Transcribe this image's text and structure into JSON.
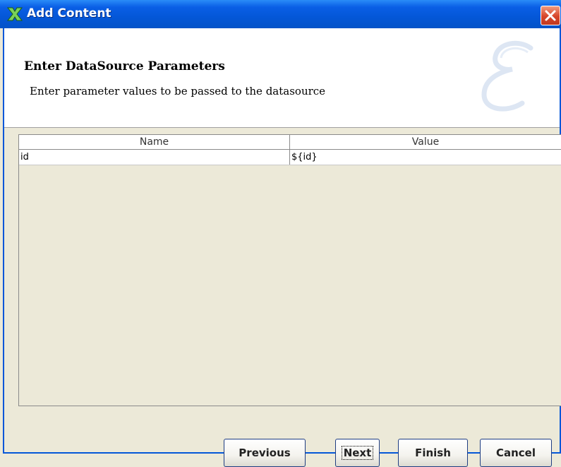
{
  "window": {
    "title": "Add Content"
  },
  "header": {
    "title": "Enter DataSource Parameters",
    "subtitle": "Enter parameter values to be passed to the datasource"
  },
  "table": {
    "columns": [
      "Name",
      "Value"
    ],
    "rows": [
      {
        "name": "id",
        "value": "${id}"
      }
    ]
  },
  "buttons": {
    "previous": "Previous",
    "next": "Next",
    "finish": "Finish",
    "cancel": "Cancel"
  },
  "colors": {
    "titlebar": "#0457d8",
    "client_bg": "#ece9d8",
    "close": "#d7452a"
  },
  "icons": {
    "app": "x-app-icon",
    "close": "close-icon",
    "logo": "script-e-logo"
  }
}
